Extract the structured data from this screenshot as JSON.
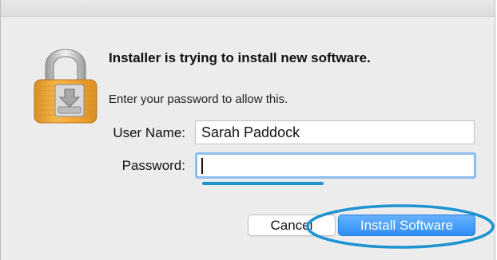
{
  "dialog": {
    "title": "Installer is trying to install new software.",
    "message": "Enter your password to allow this."
  },
  "form": {
    "username_label": "User Name:",
    "username_value": "Sarah Paddock",
    "password_label": "Password:",
    "password_value": ""
  },
  "buttons": {
    "cancel_label": "Cancel",
    "install_label": "Install Software"
  },
  "icons": {
    "lock": "lock-installer-icon"
  },
  "colors": {
    "accent": "#2f8ff5",
    "annotation": "#1f93d1",
    "focus_ring": "#8fbef0",
    "lock_body": "#f2a93b"
  }
}
